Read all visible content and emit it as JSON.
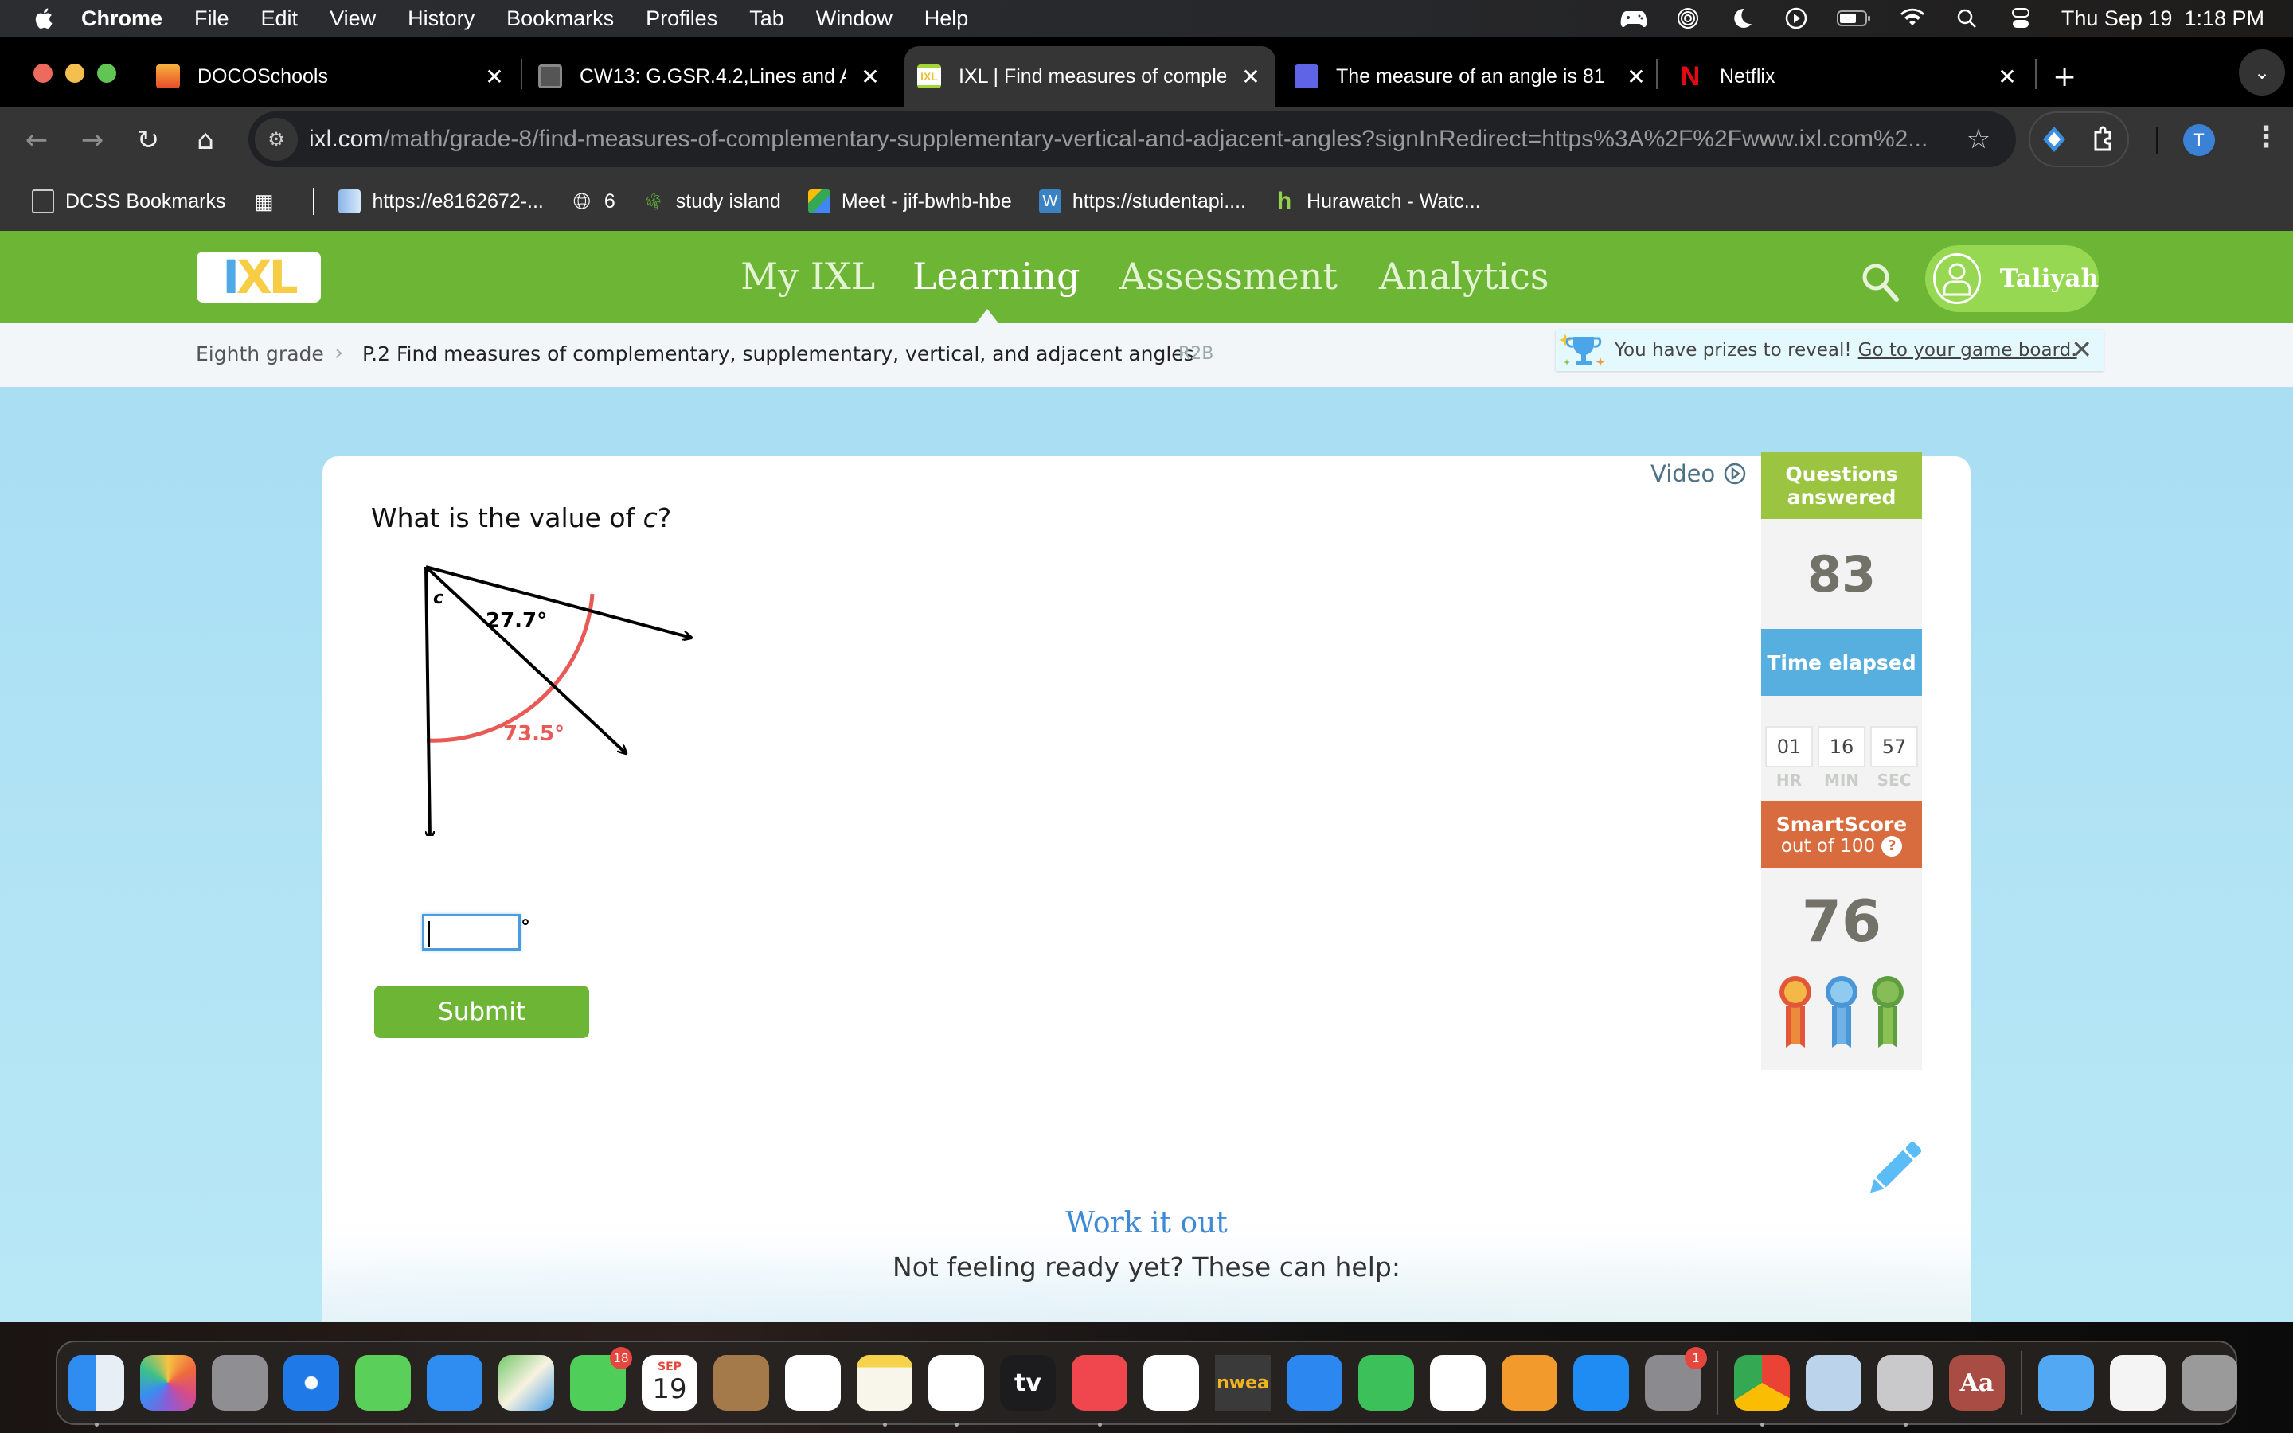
{
  "menubar": {
    "app": "Chrome",
    "items": [
      "File",
      "Edit",
      "View",
      "History",
      "Bookmarks",
      "Profiles",
      "Tab",
      "Window",
      "Help"
    ],
    "status_icons": [
      "game-controller-icon",
      "airdrop-icon",
      "focus-moon-icon",
      "play-circle-icon",
      "battery-icon",
      "wifi-icon",
      "spotlight-search-icon",
      "control-center-icon"
    ],
    "datetime": "Thu Sep 19  1:18 PM"
  },
  "browser": {
    "tabs": [
      {
        "title": "DOCOSchools",
        "favicon": "doco-flame",
        "active": false
      },
      {
        "title": "CW13: G.GSR.4.2,Lines and A",
        "favicon": "doc",
        "active": false
      },
      {
        "title": "IXL | Find measures of comple",
        "favicon": "ixl",
        "active": true
      },
      {
        "title": "The measure of an angle is 81",
        "favicon": "app-blue",
        "active": false
      },
      {
        "title": "Netflix",
        "favicon": "netflix",
        "active": false
      }
    ],
    "close_glyph": "✕",
    "new_tab_glyph": "+",
    "url_host": "ixl.com",
    "url_path": "/math/grade-8/find-measures-of-complementary-supplementary-vertical-and-adjacent-angles?signInRedirect=https%3A%2F%2Fwww.ixl.com%2...",
    "profile_initial": "T",
    "bookmarks": [
      {
        "label": "DCSS Bookmarks",
        "icon": "folder-gear"
      },
      {
        "label": "",
        "icon": "apps-grid"
      },
      {
        "label": "https://e8162672-...",
        "icon": "doc-blue"
      },
      {
        "label": "6",
        "icon": "globe"
      },
      {
        "label": "study island",
        "icon": "palm-tree"
      },
      {
        "label": "Meet - jif-bwhb-hbe",
        "icon": "meet"
      },
      {
        "label": "https://studentapi....",
        "icon": "wordpress"
      },
      {
        "label": "Hurawatch - Watc...",
        "icon": "hurawatch"
      }
    ]
  },
  "ixl": {
    "logo": {
      "i": "I",
      "x": "X",
      "l": "L"
    },
    "nav": [
      {
        "label": "My IXL",
        "active": false
      },
      {
        "label": "Learning",
        "active": true
      },
      {
        "label": "Assessment",
        "active": false
      },
      {
        "label": "Analytics",
        "active": false
      }
    ],
    "user_name": "Taliyah",
    "breadcrumb": {
      "grade": "Eighth grade",
      "skill": "P.2 Find measures of complementary, supplementary, vertical, and adjacent angles",
      "code": "R2B"
    },
    "prize_banner": {
      "text": "You have prizes to reveal!",
      "link": "Go to your game board.",
      "close": "✕"
    },
    "question": {
      "prefix": "What is the value of ",
      "variable": "c",
      "suffix": "?",
      "diagram": {
        "unknown_label": "c",
        "inner_angle_label": "27.7°",
        "total_angle_label": "73.5°"
      },
      "answer_value": "",
      "degree_symbol": "°",
      "submit_label": "Submit"
    },
    "video_label": "Video",
    "stats": {
      "questions_answered_label": "Questions answered",
      "questions_answered": "83",
      "time_elapsed_label": "Time elapsed",
      "time": {
        "hr": "01",
        "min": "16",
        "sec": "57"
      },
      "time_units": {
        "hr": "HR",
        "min": "MIN",
        "sec": "SEC"
      },
      "smartscore_label": "SmartScore",
      "smartscore_sub": "out of 100",
      "smartscore": "76",
      "help_glyph": "?"
    },
    "work_it_out": "Work it out",
    "not_ready": "Not feeling ready yet? These can help:",
    "colors": {
      "green": "#6db535",
      "questions_header": "#9bc541",
      "time_header": "#56afde",
      "smartscore_header": "#d96c3e",
      "angle_red": "#e85a55"
    }
  },
  "dock": {
    "apps": [
      {
        "name": "Finder",
        "badge": "",
        "running": true
      },
      {
        "name": "Photos",
        "badge": "",
        "running": false
      },
      {
        "name": "Launchpad",
        "badge": "",
        "running": false
      },
      {
        "name": "Safari",
        "badge": "",
        "running": false
      },
      {
        "name": "Messages",
        "badge": "",
        "running": false
      },
      {
        "name": "Mail",
        "badge": "",
        "running": false
      },
      {
        "name": "Maps",
        "badge": "",
        "running": false
      },
      {
        "name": "FaceTime",
        "badge": "18",
        "running": false
      },
      {
        "name": "Calendar",
        "badge": "",
        "running": false,
        "month": "SEP",
        "day": "19"
      },
      {
        "name": "Contacts",
        "badge": "",
        "running": false
      },
      {
        "name": "Reminders",
        "badge": "",
        "running": false
      },
      {
        "name": "Notes",
        "badge": "",
        "running": true
      },
      {
        "name": "Freeform",
        "badge": "",
        "running": true
      },
      {
        "name": "TV",
        "badge": "",
        "running": false,
        "text": "tv"
      },
      {
        "name": "Music",
        "badge": "",
        "running": true
      },
      {
        "name": "News",
        "badge": "",
        "running": false
      },
      {
        "name": "NWEA",
        "badge": "",
        "running": false,
        "text": "nwea"
      },
      {
        "name": "Keynote",
        "badge": "",
        "running": false
      },
      {
        "name": "Numbers",
        "badge": "",
        "running": false
      },
      {
        "name": "Xcode-like app",
        "badge": "",
        "running": false
      },
      {
        "name": "Pages",
        "badge": "",
        "running": false
      },
      {
        "name": "App Store",
        "badge": "",
        "running": false
      },
      {
        "name": "System Settings",
        "badge": "1",
        "running": false
      },
      {
        "name": "Google Chrome",
        "badge": "",
        "running": true
      },
      {
        "name": "Preview",
        "badge": "",
        "running": false
      },
      {
        "name": "Roblox",
        "badge": "",
        "running": true
      },
      {
        "name": "Dictionary",
        "badge": "",
        "running": false,
        "text": "Aa"
      },
      {
        "name": "Downloads",
        "badge": "",
        "running": false
      },
      {
        "name": "Recent Window",
        "badge": "",
        "running": false
      },
      {
        "name": "Trash",
        "badge": "",
        "running": false
      }
    ]
  }
}
